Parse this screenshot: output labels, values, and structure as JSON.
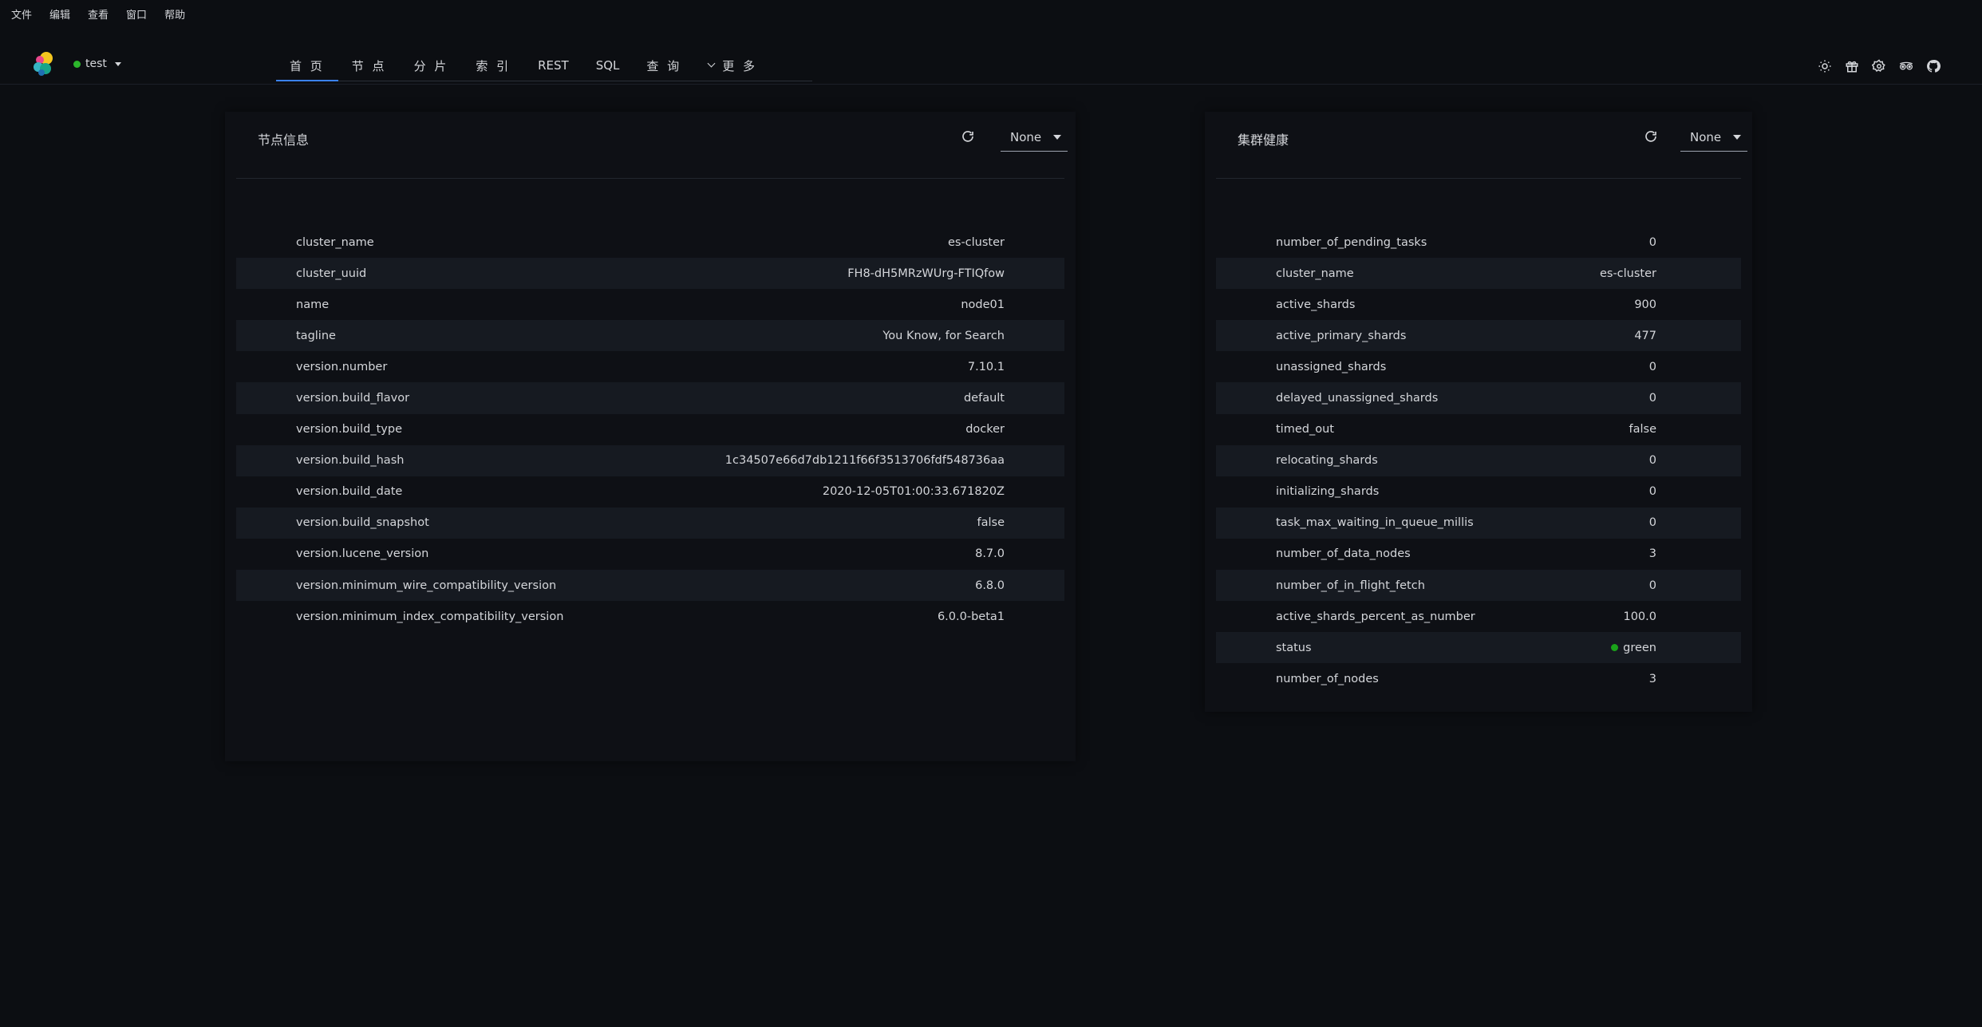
{
  "menu": [
    "文件",
    "编辑",
    "查看",
    "窗口",
    "帮助"
  ],
  "cluster": {
    "name": "test",
    "status_color": "#2cb62c"
  },
  "tabs": [
    {
      "label": "首 页",
      "active": true
    },
    {
      "label": "节 点",
      "active": false
    },
    {
      "label": "分 片",
      "active": false
    },
    {
      "label": "索 引",
      "active": false
    },
    {
      "label": "REST",
      "active": false
    },
    {
      "label": "SQL",
      "active": false
    },
    {
      "label": "查 询",
      "active": false
    },
    {
      "label": "更 多",
      "active": false
    }
  ],
  "header_icons": [
    "sun-icon",
    "gift-icon",
    "settings-icon",
    "tripadvisor-icon",
    "github-icon"
  ],
  "node_info": {
    "title": "节点信息",
    "select_value": "None",
    "rows": [
      {
        "key": "cluster_name",
        "value": "es-cluster"
      },
      {
        "key": "cluster_uuid",
        "value": "FH8-dH5MRzWUrg-FTIQfow"
      },
      {
        "key": "name",
        "value": "node01"
      },
      {
        "key": "tagline",
        "value": "You Know, for Search"
      },
      {
        "key": "version.number",
        "value": "7.10.1"
      },
      {
        "key": "version.build_flavor",
        "value": "default"
      },
      {
        "key": "version.build_type",
        "value": "docker"
      },
      {
        "key": "version.build_hash",
        "value": "1c34507e66d7db1211f66f3513706fdf548736aa"
      },
      {
        "key": "version.build_date",
        "value": "2020-12-05T01:00:33.671820Z"
      },
      {
        "key": "version.build_snapshot",
        "value": "false"
      },
      {
        "key": "version.lucene_version",
        "value": "8.7.0"
      },
      {
        "key": "version.minimum_wire_compatibility_version",
        "value": "6.8.0"
      },
      {
        "key": "version.minimum_index_compatibility_version",
        "value": "6.0.0-beta1"
      }
    ]
  },
  "cluster_health": {
    "title": "集群健康",
    "select_value": "None",
    "rows": [
      {
        "key": "number_of_pending_tasks",
        "value": "0"
      },
      {
        "key": "cluster_name",
        "value": "es-cluster"
      },
      {
        "key": "active_shards",
        "value": "900"
      },
      {
        "key": "active_primary_shards",
        "value": "477"
      },
      {
        "key": "unassigned_shards",
        "value": "0"
      },
      {
        "key": "delayed_unassigned_shards",
        "value": "0"
      },
      {
        "key": "timed_out",
        "value": "false"
      },
      {
        "key": "relocating_shards",
        "value": "0"
      },
      {
        "key": "initializing_shards",
        "value": "0"
      },
      {
        "key": "task_max_waiting_in_queue_millis",
        "value": "0"
      },
      {
        "key": "number_of_data_nodes",
        "value": "3"
      },
      {
        "key": "number_of_in_flight_fetch",
        "value": "0"
      },
      {
        "key": "active_shards_percent_as_number",
        "value": "100.0"
      },
      {
        "key": "status",
        "value": "green",
        "dot": true
      },
      {
        "key": "number_of_nodes",
        "value": "3"
      }
    ]
  }
}
